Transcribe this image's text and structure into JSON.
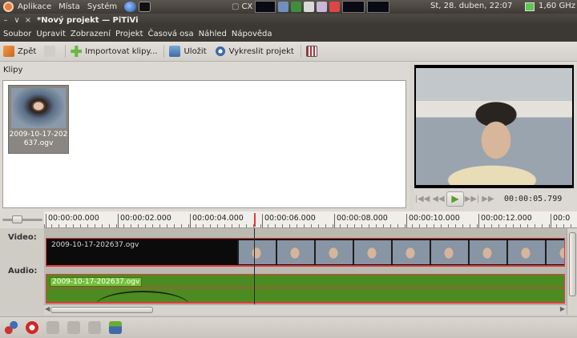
{
  "top_panel": {
    "menus": [
      "Aplikace",
      "Místa",
      "Systém"
    ],
    "tray_text": "CX",
    "clock": "St, 28. duben, 22:07",
    "cpu_freq": "1,60 GHz"
  },
  "window": {
    "title": "*Nový projekt — PiTiVi"
  },
  "menubar": [
    "Soubor",
    "Upravit",
    "Zobrazení",
    "Projekt",
    "Časová osa",
    "Náhled",
    "Nápověda"
  ],
  "toolbar": {
    "back_label": "Zpět",
    "import_label": "Importovat klipy...",
    "save_label": "Uložit",
    "render_label": "Vykreslit projekt"
  },
  "clips_panel": {
    "header": "Klipy",
    "clips": [
      {
        "name": "2009-10-17-202637.ogv"
      }
    ]
  },
  "viewer": {
    "timecode": "00:00:05.799"
  },
  "timeline": {
    "ruler_ticks": [
      "00:00:00.000",
      "00:00:02.000",
      "00:00:04.000",
      "00:00:06.000",
      "00:00:08.000",
      "00:00:10.000",
      "00:00:12.000",
      "00:0"
    ],
    "video_label": "Video:",
    "audio_label": "Audio:",
    "video_clip_name": "2009-10-17-202637.ogv",
    "audio_clip_name": "2009-10-17-202637.ogv"
  }
}
